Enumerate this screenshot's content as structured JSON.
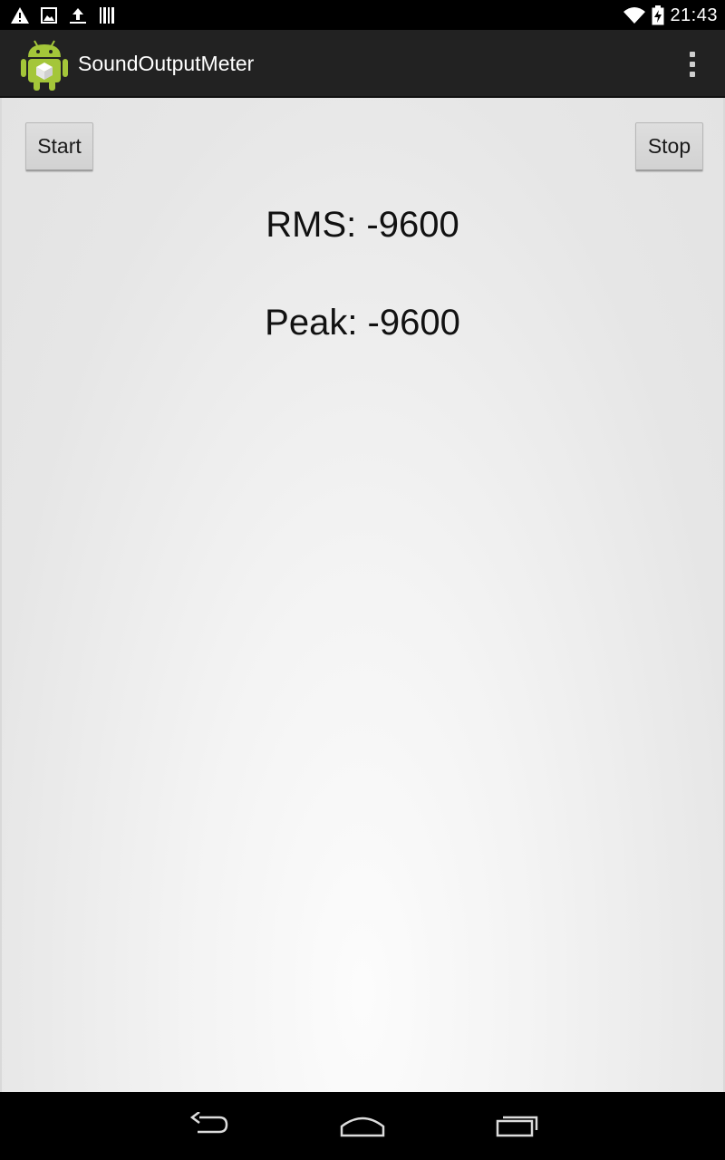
{
  "status_bar": {
    "time": "21:43",
    "left_icons": [
      "warning-icon",
      "image-icon",
      "upload-icon",
      "barcode-icon"
    ],
    "right_icons": [
      "wifi-icon",
      "battery-charging-icon"
    ]
  },
  "action_bar": {
    "app_icon": "android-app-icon",
    "title": "SoundOutputMeter",
    "overflow_icon": "overflow-menu-icon"
  },
  "content": {
    "start_label": "Start",
    "stop_label": "Stop",
    "rms_text": "RMS: -9600",
    "peak_text": "Peak: -9600"
  },
  "nav_bar": {
    "icons": [
      "back-icon",
      "home-icon",
      "recents-icon"
    ]
  },
  "colors": {
    "status_bar": "#000000",
    "action_bar": "#222222",
    "button_bg": "#d6d6d6",
    "app_icon_green": "#a4c639"
  }
}
